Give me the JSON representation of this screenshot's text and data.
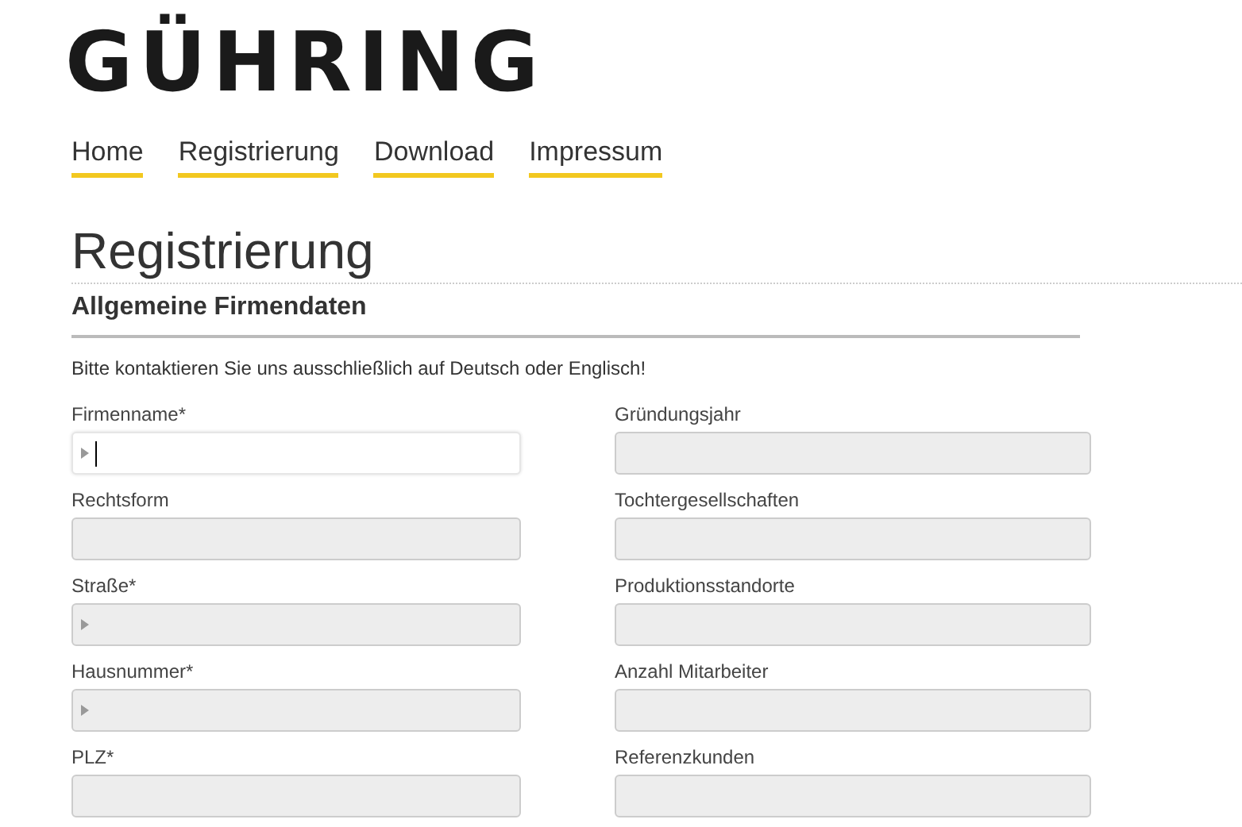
{
  "logo": "GÜHRING",
  "nav": [
    {
      "label": "Home",
      "selected": false
    },
    {
      "label": "Registrierung",
      "selected": false
    },
    {
      "label": "Download",
      "selected": false
    },
    {
      "label": "Impressum",
      "selected": false
    }
  ],
  "page_title": "Registrierung",
  "section_title": "Allgemeine Firmendaten",
  "note": "Bitte kontaktieren Sie uns ausschließlich auf Deutsch oder Englisch!",
  "fields": [
    {
      "label": "Firmenname*",
      "marker": true,
      "focused": true
    },
    {
      "label": "Gründungsjahr",
      "marker": false,
      "focused": false
    },
    {
      "label": "Rechtsform",
      "marker": false,
      "focused": false
    },
    {
      "label": "Tochtergesellschaften",
      "marker": false,
      "focused": false
    },
    {
      "label": "Straße*",
      "marker": true,
      "focused": false
    },
    {
      "label": "Produktionsstandorte",
      "marker": false,
      "focused": false
    },
    {
      "label": "Hausnummer*",
      "marker": true,
      "focused": false
    },
    {
      "label": "Anzahl Mitarbeiter",
      "marker": false,
      "focused": false
    },
    {
      "label": "PLZ*",
      "marker": false,
      "focused": false
    },
    {
      "label": "Referenzkunden",
      "marker": false,
      "focused": false
    }
  ]
}
